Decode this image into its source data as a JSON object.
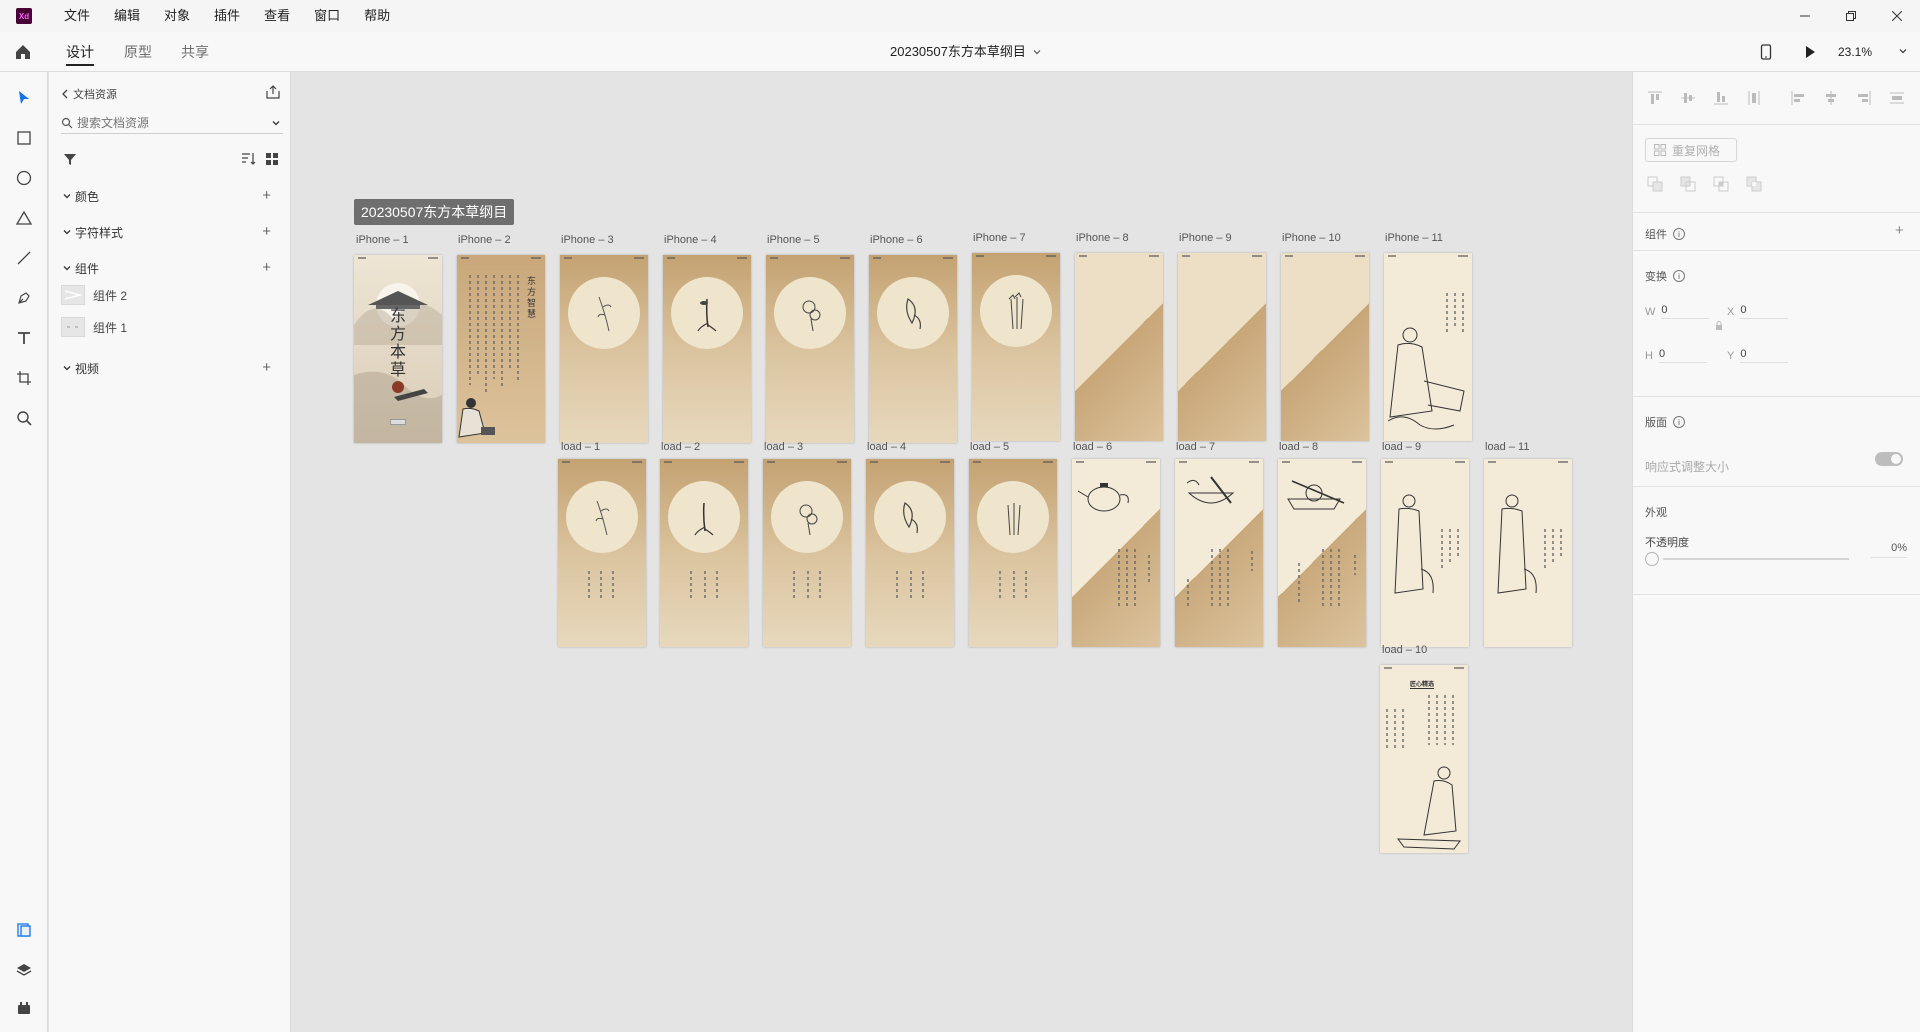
{
  "app": {
    "logo_text": "Xd",
    "menu": [
      "文件",
      "编辑",
      "对象",
      "插件",
      "查看",
      "窗口",
      "帮助"
    ],
    "window_controls": [
      "minimize-icon",
      "restore-icon",
      "close-icon"
    ]
  },
  "tabs": {
    "modes": [
      {
        "label": "设计",
        "active": true
      },
      {
        "label": "原型",
        "active": false
      },
      {
        "label": "共享",
        "active": false
      }
    ],
    "document_title": "20230507东方本草纲目",
    "zoom": "23.1%"
  },
  "toolbar": {
    "tools": [
      "select-icon",
      "rectangle-icon",
      "ellipse-icon",
      "polygon-icon",
      "line-icon",
      "pen-icon",
      "text-icon",
      "artboard-icon",
      "zoom-icon"
    ],
    "bottom": [
      "assets-icon",
      "layers-icon",
      "plugins-icon"
    ]
  },
  "assets": {
    "back_label": "文档资源",
    "search_placeholder": "搜索文档资源",
    "sections": {
      "colors": "颜色",
      "char_styles": "字符样式",
      "components": "组件",
      "video": "视频"
    },
    "components": [
      {
        "label": "组件 2"
      },
      {
        "label": "组件 1"
      }
    ]
  },
  "canvas": {
    "doc_label": "20230507东方本草纲目",
    "artboards": [
      {
        "label": "iPhone – 1",
        "style": "cover"
      },
      {
        "label": "iPhone – 2",
        "style": "scroll"
      },
      {
        "label": "iPhone – 3",
        "style": "gold"
      },
      {
        "label": "iPhone – 4",
        "style": "gold"
      },
      {
        "label": "iPhone – 5",
        "style": "gold"
      },
      {
        "label": "iPhone – 6",
        "style": "gold"
      },
      {
        "label": "iPhone – 7",
        "style": "gold"
      },
      {
        "label": "iPhone – 8",
        "style": "diag"
      },
      {
        "label": "iPhone – 9",
        "style": "diag"
      },
      {
        "label": "iPhone – 10",
        "style": "diag"
      },
      {
        "label": "iPhone – 11",
        "style": "cream"
      },
      {
        "label": "load – 1",
        "style": "gold"
      },
      {
        "label": "load – 2",
        "style": "gold"
      },
      {
        "label": "load – 3",
        "style": "gold"
      },
      {
        "label": "load – 4",
        "style": "gold"
      },
      {
        "label": "load – 5",
        "style": "gold"
      },
      {
        "label": "load – 6",
        "style": "diag2"
      },
      {
        "label": "load – 7",
        "style": "diag2"
      },
      {
        "label": "load – 8",
        "style": "diag2"
      },
      {
        "label": "load – 9",
        "style": "cream"
      },
      {
        "label": "load – 11",
        "style": "cream"
      },
      {
        "label": "load – 10",
        "style": "cream"
      }
    ],
    "cover_title": "东方本草",
    "cover_subtitle": "东方智慧",
    "headline": "匠心精选"
  },
  "properties": {
    "repeat_grid": "重复网格",
    "component_title": "组件",
    "transform_title": "变换",
    "w_label": "W",
    "w_value": "0",
    "x_label": "X",
    "x_value": "0",
    "h_label": "H",
    "h_value": "0",
    "y_label": "Y",
    "y_value": "0",
    "layout_title": "版面",
    "responsive_label": "响应式调整大小",
    "appearance_title": "外观",
    "opacity_label": "不透明度",
    "opacity_value": "0%"
  }
}
